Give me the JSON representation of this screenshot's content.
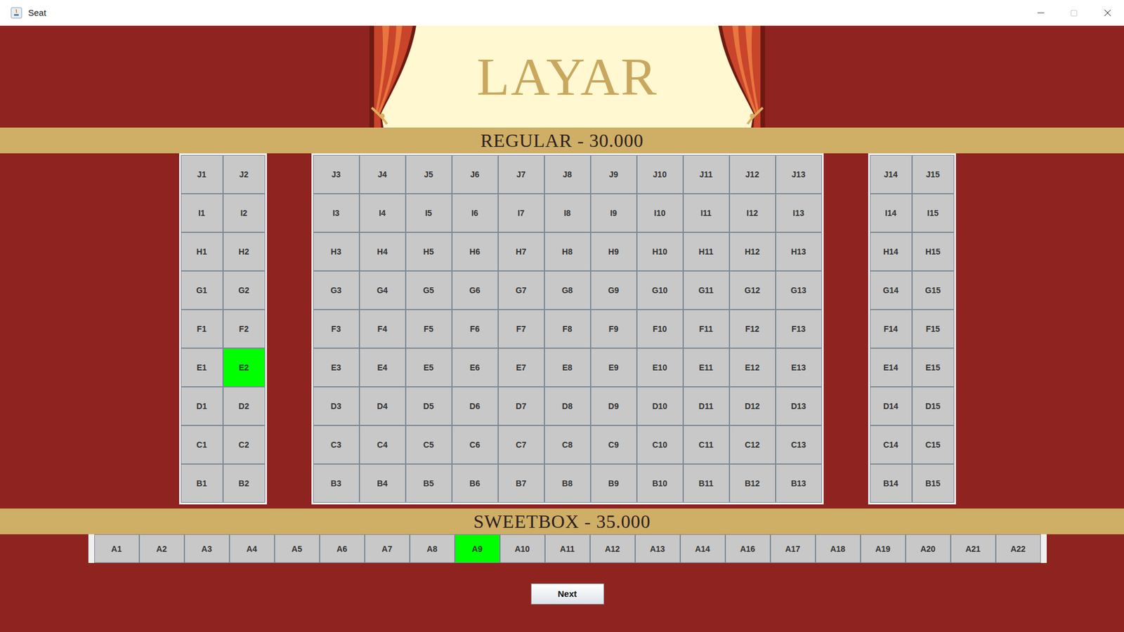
{
  "window": {
    "title": "Seat"
  },
  "screen": {
    "label": "LAYAR"
  },
  "regular": {
    "label": "REGULAR - 30.000",
    "sections": [
      {
        "rows": [
          [
            {
              "label": "J1",
              "selected": false
            },
            {
              "label": "J2",
              "selected": false
            }
          ],
          [
            {
              "label": "I1",
              "selected": false
            },
            {
              "label": "I2",
              "selected": false
            }
          ],
          [
            {
              "label": "H1",
              "selected": false
            },
            {
              "label": "H2",
              "selected": false
            }
          ],
          [
            {
              "label": "G1",
              "selected": false
            },
            {
              "label": "G2",
              "selected": false
            }
          ],
          [
            {
              "label": "F1",
              "selected": false
            },
            {
              "label": "F2",
              "selected": false
            }
          ],
          [
            {
              "label": "E1",
              "selected": false
            },
            {
              "label": "E2",
              "selected": true
            }
          ],
          [
            {
              "label": "D1",
              "selected": false
            },
            {
              "label": "D2",
              "selected": false
            }
          ],
          [
            {
              "label": "C1",
              "selected": false
            },
            {
              "label": "C2",
              "selected": false
            }
          ],
          [
            {
              "label": "B1",
              "selected": false
            },
            {
              "label": "B2",
              "selected": false
            }
          ]
        ]
      },
      {
        "rows": [
          [
            {
              "label": "J3",
              "selected": false
            },
            {
              "label": "J4",
              "selected": false
            },
            {
              "label": "J5",
              "selected": false
            },
            {
              "label": "J6",
              "selected": false
            },
            {
              "label": "J7",
              "selected": false
            },
            {
              "label": "J8",
              "selected": false
            },
            {
              "label": "J9",
              "selected": false
            },
            {
              "label": "J10",
              "selected": false
            },
            {
              "label": "J11",
              "selected": false
            },
            {
              "label": "J12",
              "selected": false
            },
            {
              "label": "J13",
              "selected": false
            }
          ],
          [
            {
              "label": "I3",
              "selected": false
            },
            {
              "label": "I4",
              "selected": false
            },
            {
              "label": "I5",
              "selected": false
            },
            {
              "label": "I6",
              "selected": false
            },
            {
              "label": "I7",
              "selected": false
            },
            {
              "label": "I8",
              "selected": false
            },
            {
              "label": "I9",
              "selected": false
            },
            {
              "label": "I10",
              "selected": false
            },
            {
              "label": "I11",
              "selected": false
            },
            {
              "label": "I12",
              "selected": false
            },
            {
              "label": "I13",
              "selected": false
            }
          ],
          [
            {
              "label": "H3",
              "selected": false
            },
            {
              "label": "H4",
              "selected": false
            },
            {
              "label": "H5",
              "selected": false
            },
            {
              "label": "H6",
              "selected": false
            },
            {
              "label": "H7",
              "selected": false
            },
            {
              "label": "H8",
              "selected": false
            },
            {
              "label": "H9",
              "selected": false
            },
            {
              "label": "H10",
              "selected": false
            },
            {
              "label": "H11",
              "selected": false
            },
            {
              "label": "H12",
              "selected": false
            },
            {
              "label": "H13",
              "selected": false
            }
          ],
          [
            {
              "label": "G3",
              "selected": false
            },
            {
              "label": "G4",
              "selected": false
            },
            {
              "label": "G5",
              "selected": false
            },
            {
              "label": "G6",
              "selected": false
            },
            {
              "label": "G7",
              "selected": false
            },
            {
              "label": "G8",
              "selected": false
            },
            {
              "label": "G9",
              "selected": false
            },
            {
              "label": "G10",
              "selected": false
            },
            {
              "label": "G11",
              "selected": false
            },
            {
              "label": "G12",
              "selected": false
            },
            {
              "label": "G13",
              "selected": false
            }
          ],
          [
            {
              "label": "F3",
              "selected": false
            },
            {
              "label": "F4",
              "selected": false
            },
            {
              "label": "F5",
              "selected": false
            },
            {
              "label": "F6",
              "selected": false
            },
            {
              "label": "F7",
              "selected": false
            },
            {
              "label": "F8",
              "selected": false
            },
            {
              "label": "F9",
              "selected": false
            },
            {
              "label": "F10",
              "selected": false
            },
            {
              "label": "F11",
              "selected": false
            },
            {
              "label": "F12",
              "selected": false
            },
            {
              "label": "F13",
              "selected": false
            }
          ],
          [
            {
              "label": "E3",
              "selected": false
            },
            {
              "label": "E4",
              "selected": false
            },
            {
              "label": "E5",
              "selected": false
            },
            {
              "label": "E6",
              "selected": false
            },
            {
              "label": "E7",
              "selected": false
            },
            {
              "label": "E8",
              "selected": false
            },
            {
              "label": "E9",
              "selected": false
            },
            {
              "label": "E10",
              "selected": false
            },
            {
              "label": "E11",
              "selected": false
            },
            {
              "label": "E12",
              "selected": false
            },
            {
              "label": "E13",
              "selected": false
            }
          ],
          [
            {
              "label": "D3",
              "selected": false
            },
            {
              "label": "D4",
              "selected": false
            },
            {
              "label": "D5",
              "selected": false
            },
            {
              "label": "D6",
              "selected": false
            },
            {
              "label": "D7",
              "selected": false
            },
            {
              "label": "D8",
              "selected": false
            },
            {
              "label": "D9",
              "selected": false
            },
            {
              "label": "D10",
              "selected": false
            },
            {
              "label": "D11",
              "selected": false
            },
            {
              "label": "D12",
              "selected": false
            },
            {
              "label": "D13",
              "selected": false
            }
          ],
          [
            {
              "label": "C3",
              "selected": false
            },
            {
              "label": "C4",
              "selected": false
            },
            {
              "label": "C5",
              "selected": false
            },
            {
              "label": "C6",
              "selected": false
            },
            {
              "label": "C7",
              "selected": false
            },
            {
              "label": "C8",
              "selected": false
            },
            {
              "label": "C9",
              "selected": false
            },
            {
              "label": "C10",
              "selected": false
            },
            {
              "label": "C11",
              "selected": false
            },
            {
              "label": "C12",
              "selected": false
            },
            {
              "label": "C13",
              "selected": false
            }
          ],
          [
            {
              "label": "B3",
              "selected": false
            },
            {
              "label": "B4",
              "selected": false
            },
            {
              "label": "B5",
              "selected": false
            },
            {
              "label": "B6",
              "selected": false
            },
            {
              "label": "B7",
              "selected": false
            },
            {
              "label": "B8",
              "selected": false
            },
            {
              "label": "B9",
              "selected": false
            },
            {
              "label": "B10",
              "selected": false
            },
            {
              "label": "B11",
              "selected": false
            },
            {
              "label": "B12",
              "selected": false
            },
            {
              "label": "B13",
              "selected": false
            }
          ]
        ]
      },
      {
        "rows": [
          [
            {
              "label": "J14",
              "selected": false
            },
            {
              "label": "J15",
              "selected": false
            }
          ],
          [
            {
              "label": "I14",
              "selected": false
            },
            {
              "label": "I15",
              "selected": false
            }
          ],
          [
            {
              "label": "H14",
              "selected": false
            },
            {
              "label": "H15",
              "selected": false
            }
          ],
          [
            {
              "label": "G14",
              "selected": false
            },
            {
              "label": "G15",
              "selected": false
            }
          ],
          [
            {
              "label": "F14",
              "selected": false
            },
            {
              "label": "F15",
              "selected": false
            }
          ],
          [
            {
              "label": "E14",
              "selected": false
            },
            {
              "label": "E15",
              "selected": false
            }
          ],
          [
            {
              "label": "D14",
              "selected": false
            },
            {
              "label": "D15",
              "selected": false
            }
          ],
          [
            {
              "label": "C14",
              "selected": false
            },
            {
              "label": "C15",
              "selected": false
            }
          ],
          [
            {
              "label": "B14",
              "selected": false
            },
            {
              "label": "B15",
              "selected": false
            }
          ]
        ]
      }
    ]
  },
  "sweetbox": {
    "label": "SWEETBOX - 35.000",
    "seats": [
      {
        "label": "A1",
        "selected": false
      },
      {
        "label": "A2",
        "selected": false
      },
      {
        "label": "A3",
        "selected": false
      },
      {
        "label": "A4",
        "selected": false
      },
      {
        "label": "A5",
        "selected": false
      },
      {
        "label": "A6",
        "selected": false
      },
      {
        "label": "A7",
        "selected": false
      },
      {
        "label": "A8",
        "selected": false
      },
      {
        "label": "A9",
        "selected": true
      },
      {
        "label": "A10",
        "selected": false
      },
      {
        "label": "A11",
        "selected": false
      },
      {
        "label": "A12",
        "selected": false
      },
      {
        "label": "A13",
        "selected": false
      },
      {
        "label": "A14",
        "selected": false
      },
      {
        "label": "A16",
        "selected": false
      },
      {
        "label": "A17",
        "selected": false
      },
      {
        "label": "A18",
        "selected": false
      },
      {
        "label": "A19",
        "selected": false
      },
      {
        "label": "A20",
        "selected": false
      },
      {
        "label": "A21",
        "selected": false
      },
      {
        "label": "A22",
        "selected": false
      }
    ]
  },
  "buttons": [
    "Next"
  ]
}
